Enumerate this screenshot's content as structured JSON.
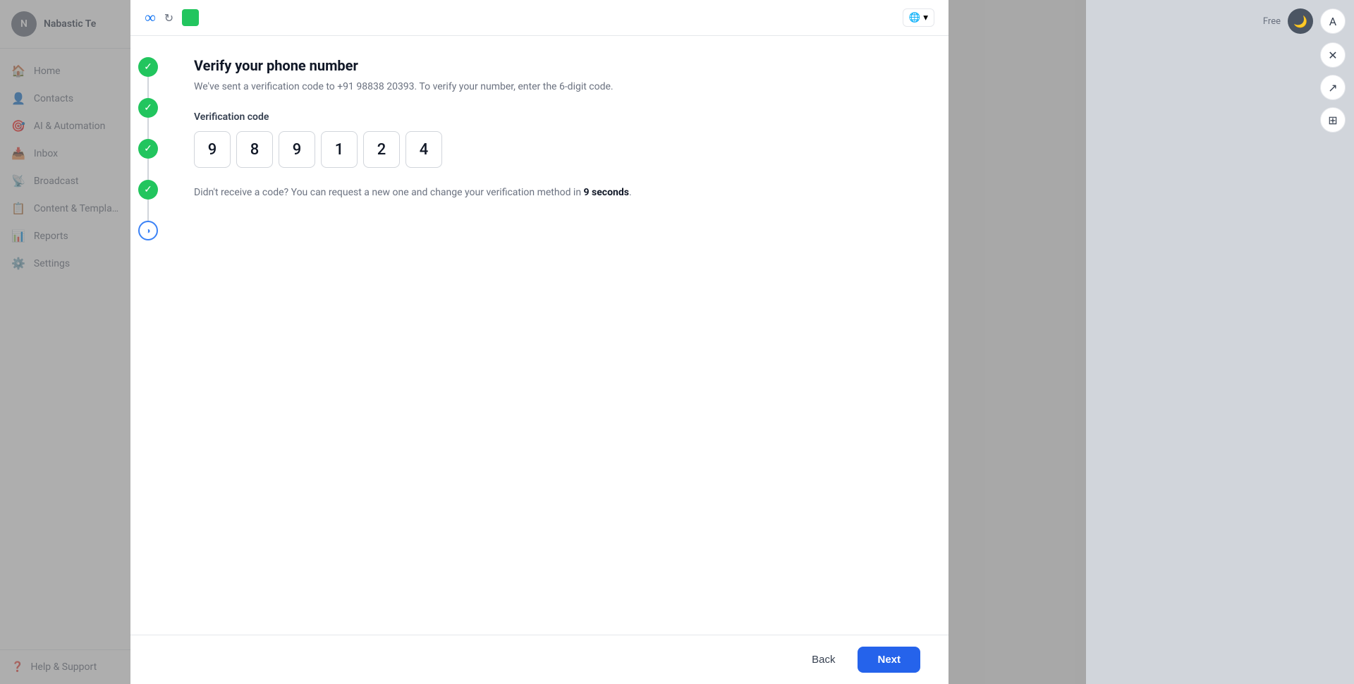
{
  "app": {
    "title": "Nabastic Te"
  },
  "sidebar": {
    "avatar_label": "N",
    "items": [
      {
        "id": "home",
        "label": "Home",
        "icon": "🏠"
      },
      {
        "id": "contacts",
        "label": "Contacts",
        "icon": "👤"
      },
      {
        "id": "ai-automation",
        "label": "AI & Automation",
        "icon": "🎯"
      },
      {
        "id": "inbox",
        "label": "Inbox",
        "icon": "📥"
      },
      {
        "id": "broadcast",
        "label": "Broadcast",
        "icon": "📡"
      },
      {
        "id": "content-templates",
        "label": "Content & Templa…",
        "icon": "📋"
      },
      {
        "id": "reports",
        "label": "Reports",
        "icon": "📊"
      },
      {
        "id": "settings",
        "label": "Settings",
        "icon": "⚙️"
      }
    ],
    "footer": {
      "help_label": "Help & Support",
      "help_icon": "❓"
    }
  },
  "modal": {
    "top_bar": {
      "meta_icon": "∞",
      "refresh_icon": "↻",
      "globe_text": "🌐 ▾"
    },
    "steps": [
      {
        "status": "completed"
      },
      {
        "status": "completed"
      },
      {
        "status": "completed"
      },
      {
        "status": "completed"
      },
      {
        "status": "active",
        "icon": "◑"
      }
    ],
    "content": {
      "title": "Verify your phone number",
      "subtitle": "We've sent a verification code to +91 98838 20393. To verify your number, enter the 6-digit code.",
      "code_label": "Verification code",
      "digits": [
        "9",
        "8",
        "9",
        "1",
        "2",
        "4"
      ],
      "resend_text_prefix": "Didn't receive a code? You can request a new one and change your verification method in ",
      "resend_seconds": "9 seconds",
      "resend_text_suffix": "."
    },
    "footer": {
      "back_label": "Back",
      "next_label": "Next"
    }
  },
  "right_panel": {
    "close_icon": "✕",
    "expand_icon": "↗",
    "grid_icon": "⊞",
    "free_label": "Free",
    "moon_icon": "🌙",
    "letter": "A"
  }
}
